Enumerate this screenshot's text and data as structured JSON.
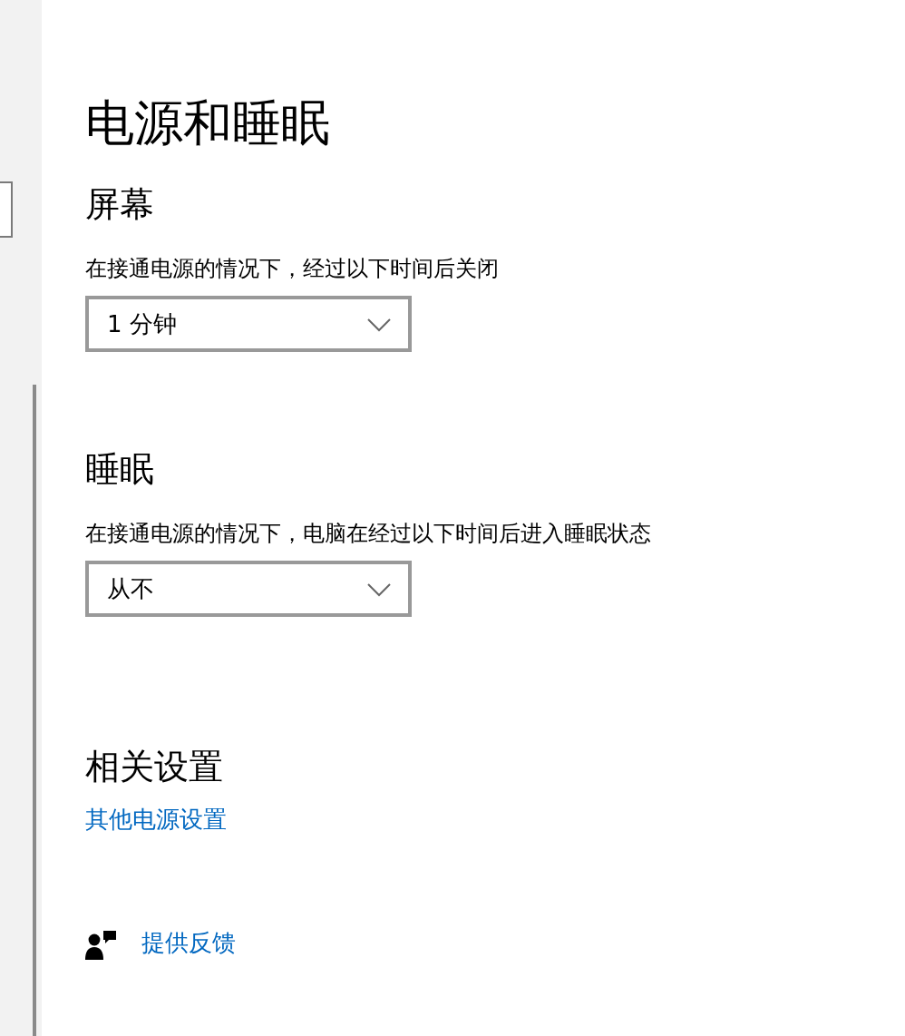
{
  "title": "电源和睡眠",
  "sections": [
    {
      "heading": "屏幕",
      "description": "在接通电源的情况下，经过以下时间后关闭",
      "dropdown": {
        "value": "1 分钟"
      }
    },
    {
      "heading": "睡眠",
      "description": "在接通电源的情况下，电脑在经过以下时间后进入睡眠状态",
      "dropdown": {
        "value": "从不"
      }
    }
  ],
  "related": {
    "heading": "相关设置",
    "links": [
      "其他电源设置"
    ]
  },
  "feedback": {
    "label": "提供反馈"
  }
}
